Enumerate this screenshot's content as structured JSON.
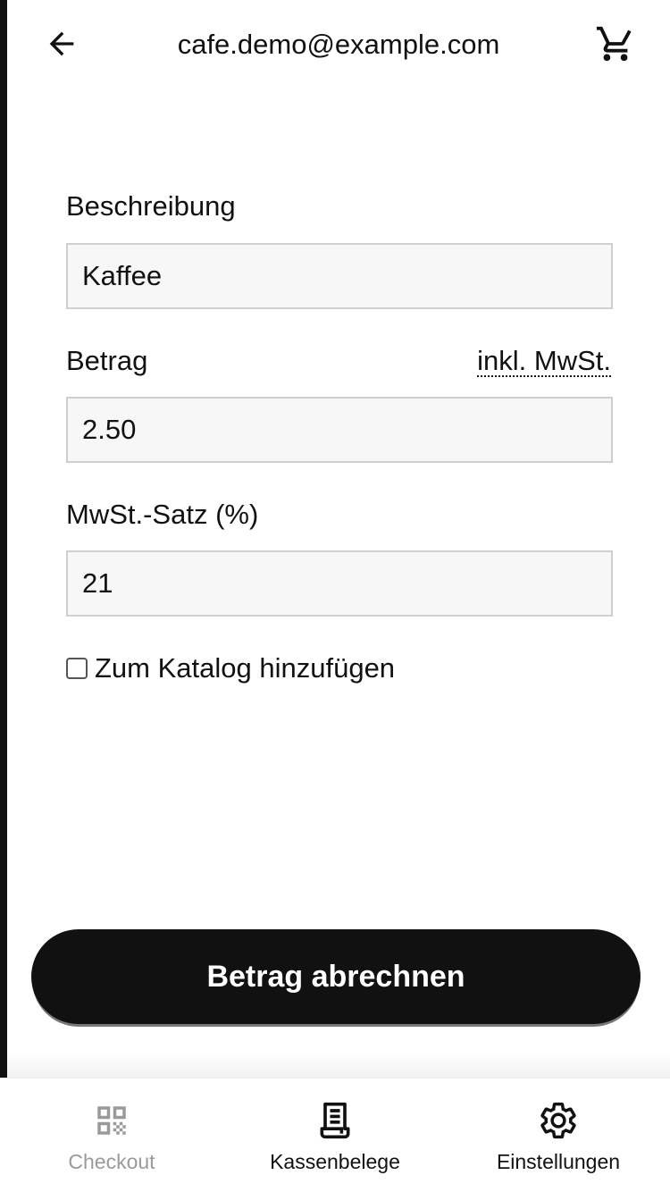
{
  "header": {
    "title": "cafe.demo@example.com",
    "back_icon": "arrow-left-icon",
    "cart_icon": "shopping-cart-icon"
  },
  "form": {
    "description": {
      "label": "Beschreibung",
      "value": "Kaffee"
    },
    "amount": {
      "label": "Betrag",
      "hint": "inkl. MwSt.",
      "value": "2.50"
    },
    "vat_rate": {
      "label": "MwSt.-Satz (%)",
      "value": "21"
    },
    "add_to_catalog": {
      "label": "Zum Katalog hinzufügen",
      "checked": false
    }
  },
  "submit_label": "Betrag abrechnen",
  "nav": {
    "items": [
      {
        "label": "Checkout",
        "icon": "qr-code-icon",
        "state": "disabled"
      },
      {
        "label": "Kassenbelege",
        "icon": "receipt-icon",
        "state": "normal"
      },
      {
        "label": "Einstellungen",
        "icon": "gear-icon",
        "state": "normal"
      }
    ]
  },
  "colors": {
    "primary": "#111111",
    "field_background": "#f7f7f7",
    "field_border": "#cfcfcf",
    "disabled_text": "#9a9a9a"
  }
}
